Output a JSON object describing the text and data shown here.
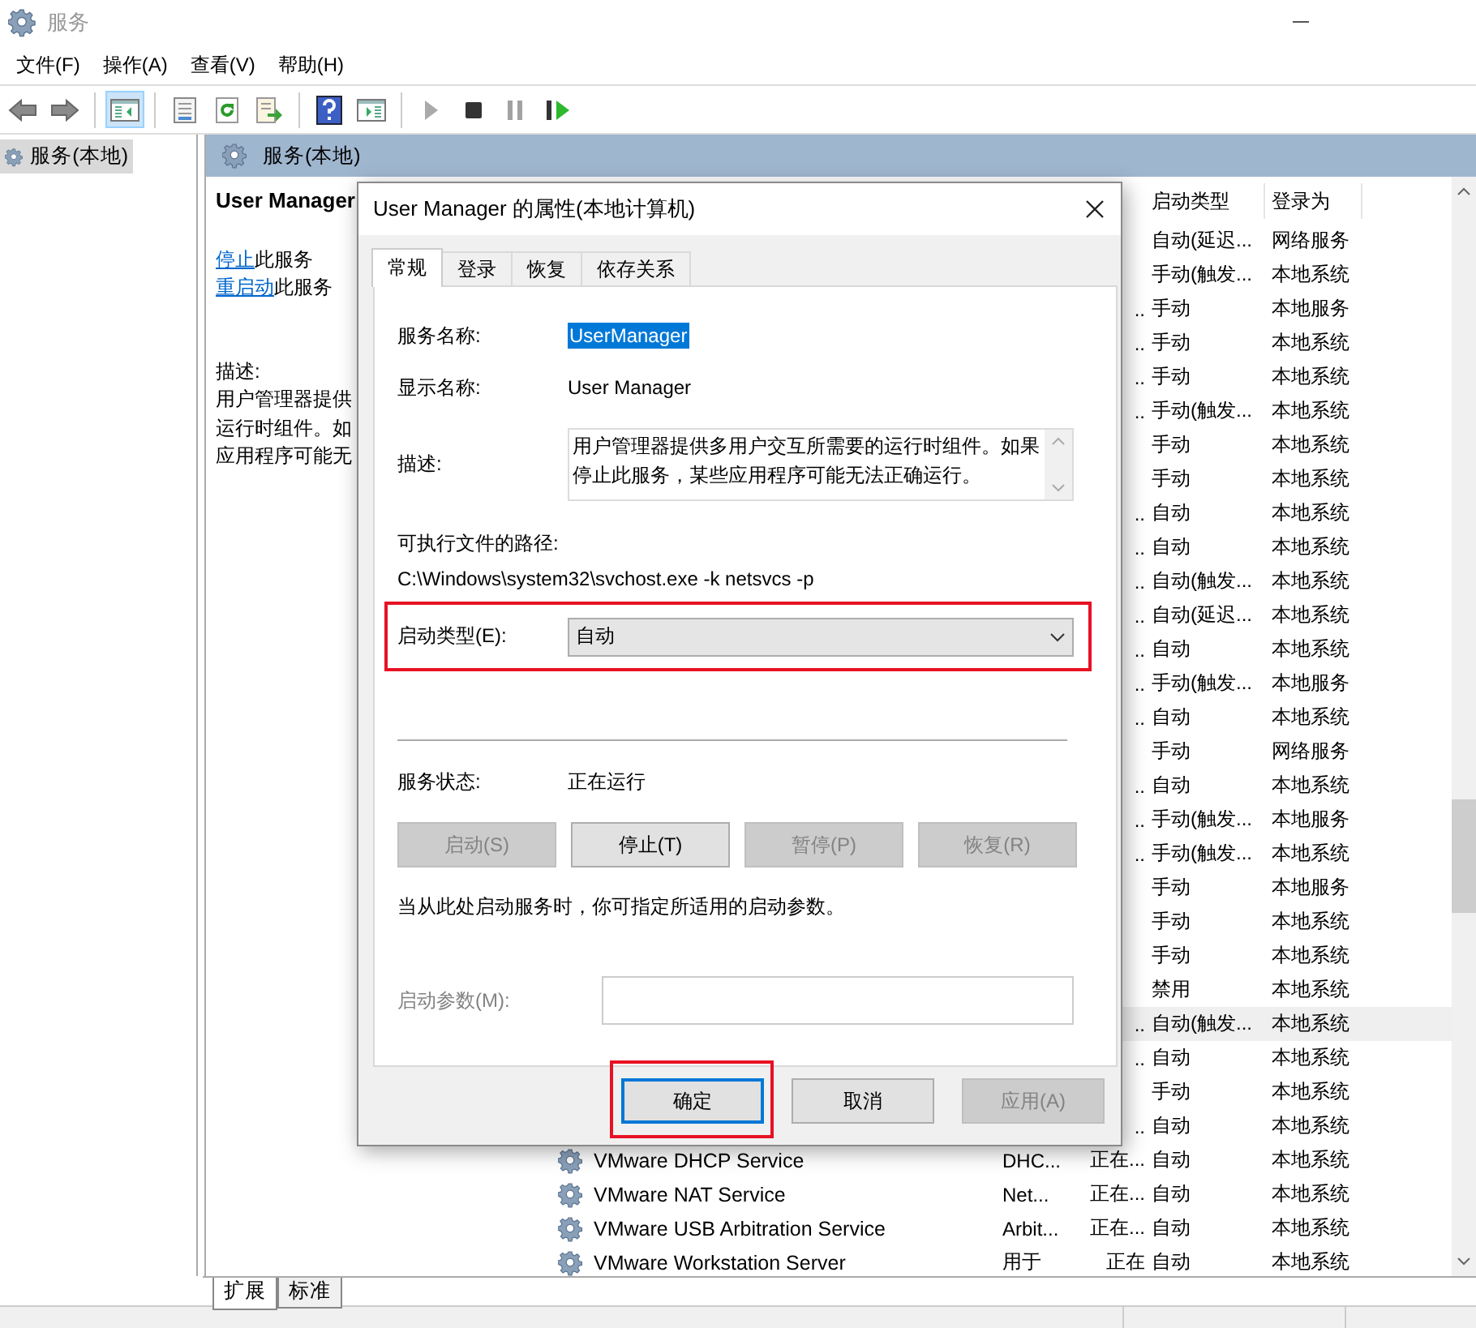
{
  "window": {
    "title": "服务"
  },
  "menu": [
    "文件(F)",
    "操作(A)",
    "查看(V)",
    "帮助(H)"
  ],
  "toolbar": [
    {
      "kind": "back",
      "pressed": false,
      "disabled": false
    },
    {
      "kind": "forward",
      "pressed": false,
      "disabled": false
    },
    {
      "kind": "separator"
    },
    {
      "kind": "tree",
      "pressed": true,
      "disabled": false
    },
    {
      "kind": "separator"
    },
    {
      "kind": "properties",
      "pressed": false,
      "disabled": false
    },
    {
      "kind": "refresh",
      "pressed": false,
      "disabled": false
    },
    {
      "kind": "export",
      "pressed": false,
      "disabled": false
    },
    {
      "kind": "separator"
    },
    {
      "kind": "help",
      "pressed": false,
      "disabled": false
    },
    {
      "kind": "actionpane",
      "pressed": false,
      "disabled": false
    },
    {
      "kind": "separator"
    },
    {
      "kind": "start",
      "pressed": false,
      "disabled": true
    },
    {
      "kind": "stop",
      "pressed": false,
      "disabled": false
    },
    {
      "kind": "pause",
      "pressed": false,
      "disabled": true
    },
    {
      "kind": "resume",
      "pressed": false,
      "disabled": false
    }
  ],
  "tree": [
    {
      "label": "服务(本地)",
      "selected": true
    }
  ],
  "panel": {
    "title": "服务(本地)",
    "service_name": "User Manager",
    "actions": [
      {
        "link": "停止",
        "text": "此服务"
      },
      {
        "link": "重启动",
        "text": "此服务"
      }
    ],
    "description_label": "描述:",
    "description_lines": [
      "用户管理器提供",
      "运行时组件。如",
      "应用程序可能无"
    ],
    "columns": [
      "启动类型",
      "登录为"
    ],
    "rows": [
      {
        "status": "",
        "startup": "自动(延迟...",
        "logon": "网络服务",
        "selected": false
      },
      {
        "status": "",
        "startup": "手动(触发...",
        "logon": "本地系统",
        "selected": false
      },
      {
        "status": "..",
        "startup": "手动",
        "logon": "本地服务",
        "selected": false
      },
      {
        "status": "..",
        "startup": "手动",
        "logon": "本地系统",
        "selected": false
      },
      {
        "status": "..",
        "startup": "手动",
        "logon": "本地系统",
        "selected": false
      },
      {
        "status": "..",
        "startup": "手动(触发...",
        "logon": "本地系统",
        "selected": false
      },
      {
        "status": "",
        "startup": "手动",
        "logon": "本地系统",
        "selected": false
      },
      {
        "status": "",
        "startup": "手动",
        "logon": "本地系统",
        "selected": false
      },
      {
        "status": "..",
        "startup": "自动",
        "logon": "本地系统",
        "selected": false
      },
      {
        "status": "..",
        "startup": "自动",
        "logon": "本地系统",
        "selected": false
      },
      {
        "status": "..",
        "startup": "自动(触发...",
        "logon": "本地系统",
        "selected": false
      },
      {
        "status": "..",
        "startup": "自动(延迟...",
        "logon": "本地系统",
        "selected": false
      },
      {
        "status": "..",
        "startup": "自动",
        "logon": "本地系统",
        "selected": false
      },
      {
        "status": "..",
        "startup": "手动(触发...",
        "logon": "本地服务",
        "selected": false
      },
      {
        "status": "..",
        "startup": "自动",
        "logon": "本地系统",
        "selected": false
      },
      {
        "status": "",
        "startup": "手动",
        "logon": "网络服务",
        "selected": false
      },
      {
        "status": "..",
        "startup": "自动",
        "logon": "本地系统",
        "selected": false
      },
      {
        "status": "..",
        "startup": "手动(触发...",
        "logon": "本地服务",
        "selected": false
      },
      {
        "status": "..",
        "startup": "手动(触发...",
        "logon": "本地系统",
        "selected": false
      },
      {
        "status": "",
        "startup": "手动",
        "logon": "本地服务",
        "selected": false
      },
      {
        "status": "",
        "startup": "手动",
        "logon": "本地系统",
        "selected": false
      },
      {
        "status": "",
        "startup": "手动",
        "logon": "本地系统",
        "selected": false
      },
      {
        "status": "",
        "startup": "禁用",
        "logon": "本地系统",
        "selected": false
      },
      {
        "status": "..",
        "startup": "自动(触发...",
        "logon": "本地系统",
        "selected": true
      },
      {
        "status": "..",
        "startup": "自动",
        "logon": "本地系统",
        "selected": false
      },
      {
        "status": "",
        "startup": "手动",
        "logon": "本地系统",
        "selected": false
      },
      {
        "status": "..",
        "startup": "自动",
        "logon": "本地系统",
        "selected": false
      },
      {
        "name": "VMware DHCP Service",
        "description": "DHC...",
        "status": "正在...",
        "startup": "自动",
        "logon": "本地系统",
        "selected": false
      },
      {
        "name": "VMware NAT Service",
        "description": "Net...",
        "status": "正在...",
        "startup": "自动",
        "logon": "本地系统",
        "selected": false
      },
      {
        "name": "VMware USB Arbitration Service",
        "description": "Arbit...",
        "status": "正在...",
        "startup": "自动",
        "logon": "本地系统",
        "selected": false
      },
      {
        "name": "VMware Workstation Server",
        "description": "用于",
        "status": "正在",
        "startup": "自动",
        "logon": "本地系统",
        "selected": false
      }
    ]
  },
  "view_tabs": [
    {
      "label": "扩展",
      "selected": true
    },
    {
      "label": "标准",
      "selected": false
    }
  ],
  "dialog": {
    "title": "User Manager 的属性(本地计算机)",
    "tabs": [
      {
        "label": "常规",
        "selected": true
      },
      {
        "label": "登录",
        "selected": false
      },
      {
        "label": "恢复",
        "selected": false
      },
      {
        "label": "依存关系",
        "selected": false
      }
    ],
    "service_name_label": "服务名称:",
    "service_name": "UserManager",
    "display_name_label": "显示名称:",
    "display_name": "User Manager",
    "description_label": "描述:",
    "description": "用户管理器提供多用户交互所需要的运行时组件。如果停止此服务，某些应用程序可能无法正确运行。",
    "path_label": "可执行文件的路径:",
    "path": "C:\\Windows\\system32\\svchost.exe -k netsvcs -p",
    "startup_label": "启动类型(E):",
    "startup_value": "自动",
    "startup_highlighted": true,
    "status_label": "服务状态:",
    "status_value": "正在运行",
    "control_buttons": [
      {
        "label": "启动(S)",
        "disabled": true
      },
      {
        "label": "停止(T)",
        "disabled": false
      },
      {
        "label": "暂停(P)",
        "disabled": true
      },
      {
        "label": "恢复(R)",
        "disabled": true
      }
    ],
    "hint": "当从此处启动服务时，你可指定所适用的启动参数。",
    "params_label": "启动参数(M):",
    "params_disabled": true,
    "buttons": [
      {
        "label": "确定",
        "default": true,
        "highlighted": true,
        "disabled": false
      },
      {
        "label": "取消",
        "default": false,
        "highlighted": false,
        "disabled": false
      },
      {
        "label": "应用(A)",
        "default": false,
        "highlighted": false,
        "disabled": true
      }
    ]
  }
}
